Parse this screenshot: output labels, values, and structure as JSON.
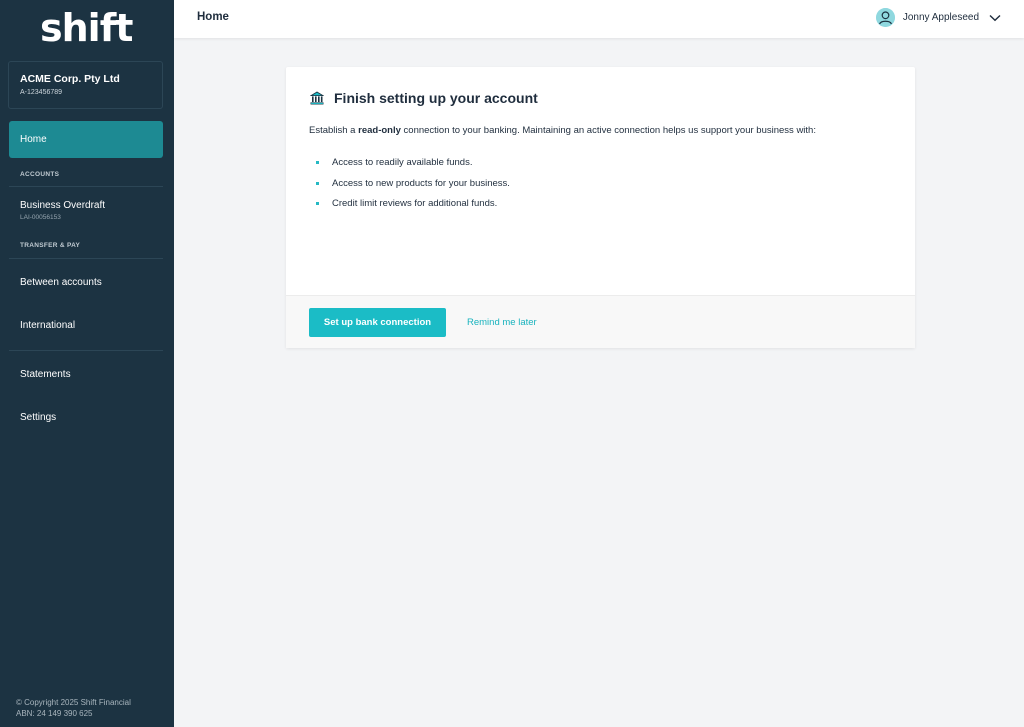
{
  "brand": {
    "logo_text": "shift",
    "accent": "#25c3cb",
    "sidebar_bg": "#1c3342"
  },
  "org": {
    "name": "ACME Corp. Pty Ltd",
    "id": "A-123456789"
  },
  "sidebar": {
    "home": "Home",
    "accounts_label": "ACCOUNTS",
    "account": {
      "name": "Business Overdraft",
      "id": "LAI-00056153"
    },
    "transfer_label": "TRANSFER & PAY",
    "between": "Between accounts",
    "international": "International",
    "statements": "Statements",
    "settings": "Settings",
    "copyright_1": "© Copyright 2025 Shift Financial",
    "copyright_2": "ABN: 24 149 390 625"
  },
  "header": {
    "title": "Home",
    "user_name": "Jonny Appleseed"
  },
  "card": {
    "title": "Finish setting up your account",
    "intro_pre": "Establish a ",
    "intro_bold": "read-only",
    "intro_post": " connection to your banking. Maintaining an active connection helps us support your business with:",
    "bullets": [
      "Access to readily available funds.",
      "Access to new products for your business.",
      "Credit limit reviews for additional funds."
    ],
    "primary_button": "Set up bank connection",
    "secondary_link": "Remind me later"
  },
  "icons": {
    "bank": "bank-icon",
    "user": "user-avatar-icon",
    "chevron": "chevron-down-icon"
  }
}
